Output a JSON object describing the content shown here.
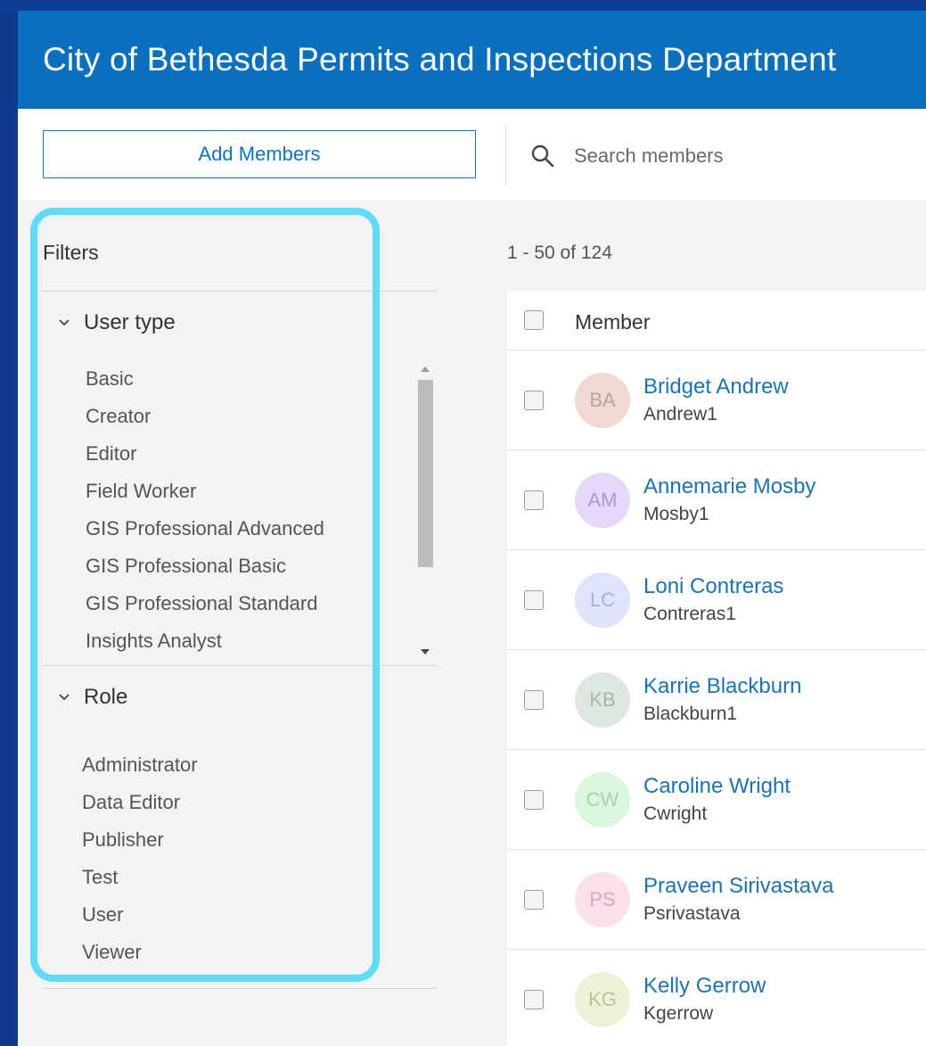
{
  "header": {
    "title": "City of Bethesda Permits and Inspections Department"
  },
  "toolbar": {
    "add_members_label": "Add Members",
    "search_placeholder": "Search members",
    "search_icon": "search-icon"
  },
  "filters": {
    "title": "Filters",
    "user_type": {
      "label": "User type",
      "items": [
        "Basic",
        "Creator",
        "Editor",
        "Field Worker",
        "GIS Professional Advanced",
        "GIS Professional Basic",
        "GIS Professional Standard",
        "Insights Analyst"
      ]
    },
    "role": {
      "label": "Role",
      "items": [
        "Administrator",
        "Data Editor",
        "Publisher",
        "Test",
        "User",
        "Viewer"
      ]
    }
  },
  "results": {
    "count_text": "1 - 50 of 124",
    "column_member": "Member"
  },
  "members": [
    {
      "initials": "BA",
      "name": "Bridget Andrew",
      "username": "Andrew1",
      "bg": "#f0d9d4",
      "fg": "#b9a49e"
    },
    {
      "initials": "AM",
      "name": "Annemarie Mosby",
      "username": "Mosby1",
      "bg": "#e6d8f8",
      "fg": "#ad9ad3"
    },
    {
      "initials": "LC",
      "name": "Loni Contreras",
      "username": "Contreras1",
      "bg": "#dde4fb",
      "fg": "#a5b1d8"
    },
    {
      "initials": "KB",
      "name": "Karrie Blackburn",
      "username": "Blackburn1",
      "bg": "#dde7e0",
      "fg": "#a7b6ab"
    },
    {
      "initials": "CW",
      "name": "Caroline Wright",
      "username": "Cwright",
      "bg": "#d9f7dc",
      "fg": "#a7d3ac"
    },
    {
      "initials": "PS",
      "name": "Praveen Sirivastava",
      "username": "Psrivastava",
      "bg": "#fbe0ec",
      "fg": "#d9a7bf"
    },
    {
      "initials": "KG",
      "name": "Kelly Gerrow",
      "username": "Kgerrow",
      "bg": "#eef1d5",
      "fg": "#bcc19e"
    }
  ]
}
